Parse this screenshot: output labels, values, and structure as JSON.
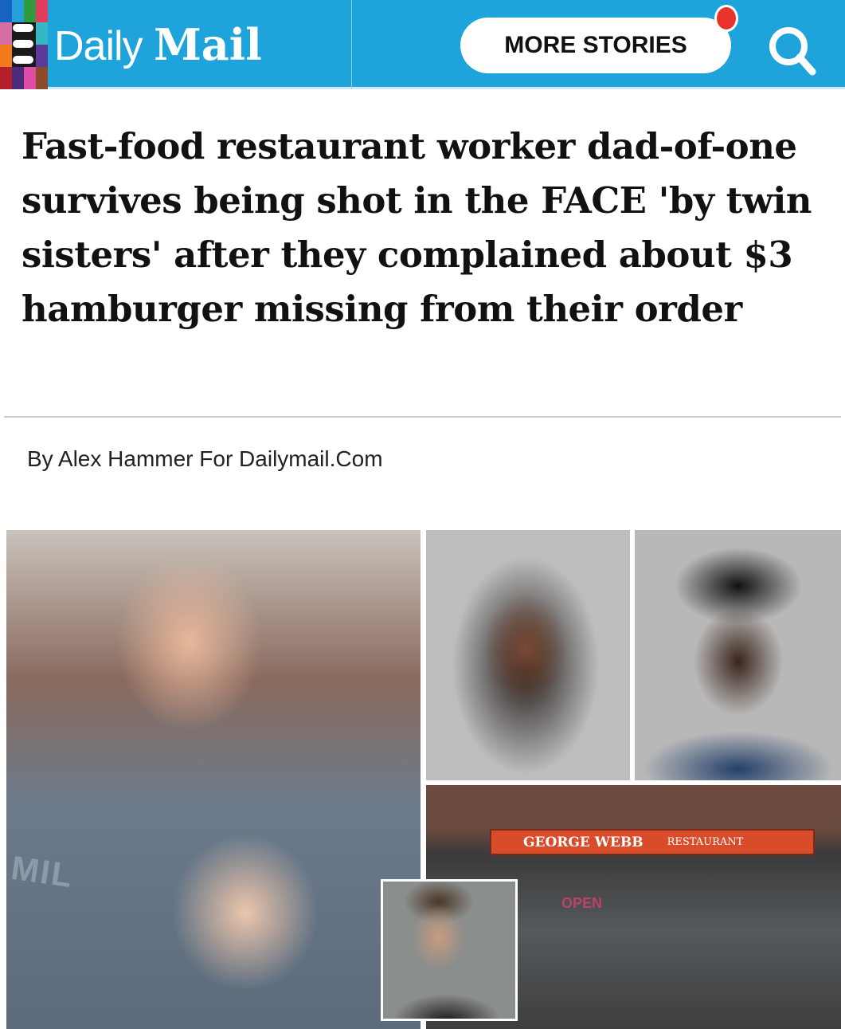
{
  "header": {
    "brand_part1": "Daily",
    "brand_part2": "Mail",
    "more_stories_label": "MORE STORIES",
    "menu_icon": "hamburger-menu-icon",
    "search_icon": "search-icon",
    "notification_dot_color": "#e8322b",
    "bar_color": "#1ea3db",
    "tile_colors": [
      "#1565c0",
      "#26a0d8",
      "#2e9b3e",
      "#e23b5b",
      "#d66fa6",
      "#1a1a1a",
      "#1a1a1a",
      "#35b7c4",
      "#f07a1c",
      "#1a1a1a",
      "#1a1a1a",
      "#5b3a9a",
      "#b3202a",
      "#4b2c7a",
      "#e04da6",
      "#8b4a2a"
    ]
  },
  "article": {
    "headline": "Fast-food restaurant worker dad-of-one survives being shot in the FACE 'by twin sisters' after they complained about $3 hamburger missing from their order",
    "byline": "By Alex Hammer For Dailymail.Com"
  },
  "photos": {
    "sign_name": "GEORGE WEBB",
    "sign_type": "RESTAURANT",
    "open_sign": "OPEN",
    "shirt_text": "MIL"
  }
}
